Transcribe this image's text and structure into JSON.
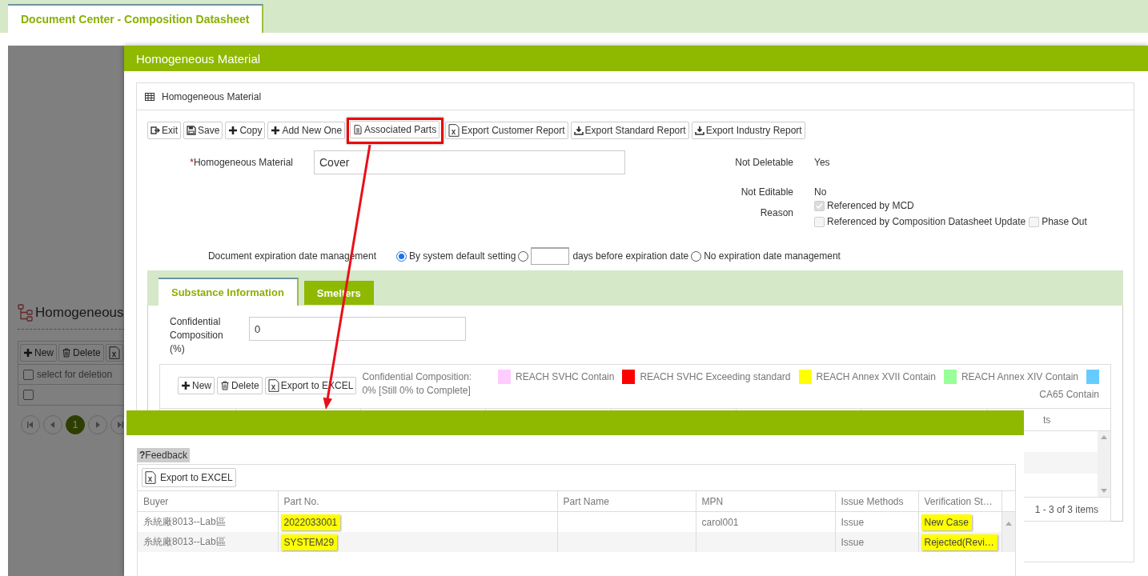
{
  "tabs": [
    {
      "label": "Document Center - Composition Datasheet",
      "selected": true
    }
  ],
  "background_page": {
    "title": "Homogeneous",
    "toolbar": [
      {
        "label": "New",
        "kind": "plus"
      },
      {
        "label": "Delete",
        "kind": "trash"
      },
      {
        "kind": "excel"
      }
    ],
    "select_all": {
      "label": "select for deletion",
      "checked": false
    },
    "rows": [
      {
        "checked": false
      }
    ],
    "pages": [
      {
        "label": "1",
        "selected": true
      }
    ]
  },
  "dialog": {
    "title": "Homogeneous Material",
    "panel_title": "Homogeneous Material",
    "toolbar": [
      {
        "label": "Exit",
        "kind": "exit",
        "highlighted": false
      },
      {
        "label": "Save",
        "kind": "save",
        "highlighted": false
      },
      {
        "label": "Copy",
        "kind": "plus",
        "highlighted": false
      },
      {
        "label": "Add New One",
        "kind": "plus",
        "highlighted": false
      },
      {
        "label": "Associated Parts",
        "kind": "doc",
        "highlighted": true
      },
      {
        "label": "Export Customer Report",
        "kind": "excel",
        "highlighted": false
      },
      {
        "label": "Export Standard Report",
        "kind": "download",
        "highlighted": false
      },
      {
        "label": "Export Industry Report",
        "kind": "download",
        "highlighted": false
      }
    ],
    "material": {
      "required_mark": "*",
      "label": "Homogeneous Material",
      "value": "Cover"
    },
    "not_deletable": {
      "label": "Not Deletable",
      "value": "Yes"
    },
    "not_editable": {
      "label": "Not Editable",
      "value": "No"
    },
    "reason": {
      "label": "Reason",
      "disabled": true,
      "options": [
        {
          "label": "Referenced by MCD",
          "checked": true
        },
        {
          "label": "Referenced by Composition Datasheet Update",
          "checked": false
        },
        {
          "label": "Phase Out",
          "checked": false
        }
      ]
    },
    "expiration": {
      "label": "Document expiration date management",
      "options": [
        {
          "kind": "plain",
          "label": "By system default setting",
          "selected": true
        },
        {
          "kind": "days",
          "label": "days before expiration date",
          "selected": false
        },
        {
          "kind": "plain",
          "label": "No expiration date management",
          "selected": false
        }
      ]
    },
    "subtabs": [
      {
        "label": "Substance Information",
        "selected": true
      },
      {
        "label": "Smelters",
        "selected": false
      }
    ],
    "confidential": {
      "label": "Confidential Composition (%)",
      "value": "0"
    },
    "grid_toolbar": [
      {
        "label": "New",
        "kind": "plus"
      },
      {
        "label": "Delete",
        "kind": "trash"
      },
      {
        "label": "Export to EXCEL",
        "kind": "excel"
      }
    ],
    "confidential_note": "Confidential Composition: 0% [Still 0% to Complete]",
    "legend": [
      {
        "label": "REACH SVHC Contain",
        "color": "#ffccff"
      },
      {
        "label": "REACH SVHC Exceeding standard",
        "color": "#ff0000"
      },
      {
        "label": "REACH Annex XVII Contain",
        "color": "#ffff00"
      },
      {
        "label": "REACH Annex XIV Contain",
        "color": "#99ff99"
      },
      {
        "label": "CA65 Contain",
        "color": "#66ccff"
      }
    ],
    "grid_last_column": "ts",
    "pager_info": "1 - 3 of 3 items"
  },
  "parts_popup": {
    "feedback": "**?**Feedback",
    "export": "Export to EXCEL",
    "columns": [
      {
        "label": "Buyer",
        "highlighted": false
      },
      {
        "label": "Part No.",
        "highlighted": true
      },
      {
        "label": "Part Name",
        "highlighted": false
      },
      {
        "label": "MPN",
        "highlighted": false
      },
      {
        "label": "Issue Methods",
        "highlighted": false
      },
      {
        "label": "Verification St…",
        "highlighted": true
      }
    ],
    "rows": [
      {
        "cells": [
          "糸統廠8013--Lab區",
          "2022033001",
          "",
          "carol001",
          "Issue",
          "New Case"
        ]
      },
      {
        "cells": [
          "糸統廠8013--Lab區",
          "SYSTEM29",
          "",
          "",
          "Issue",
          "Rejected(Revi…"
        ]
      }
    ]
  }
}
